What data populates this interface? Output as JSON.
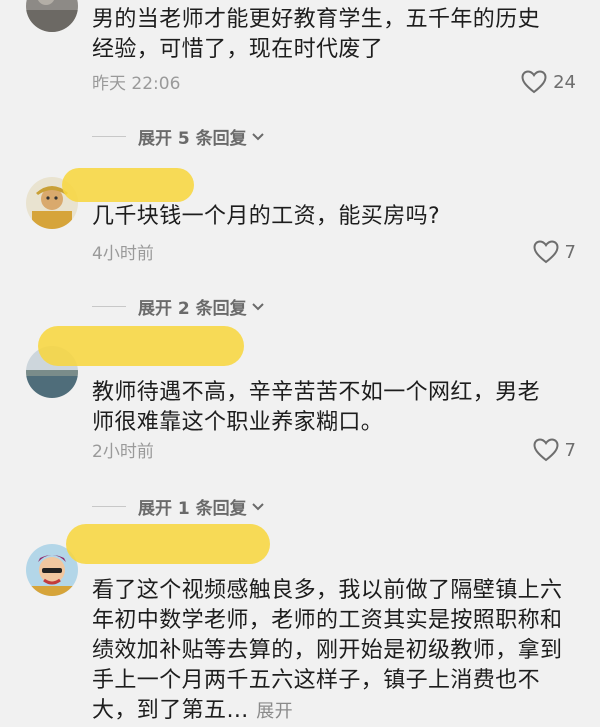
{
  "comments": [
    {
      "text": "男的当老师才能更好教育学生，五千年的历史经验，可惜了，现在时代废了",
      "time": "昨天 22:06",
      "likes": "24",
      "replies_label": "展开 5 条回复"
    },
    {
      "user": "",
      "text": "几千块钱一个月的工资，能买房吗?",
      "time": "4小时前",
      "likes": "7",
      "replies_label": "展开 2 条回复"
    },
    {
      "user": "",
      "text": "教师待遇不高，辛辛苦苦不如一个网红，男老师很难靠这个职业养家糊口。",
      "time": "2小时前",
      "likes": "7",
      "replies_label": "展开 1 条回复"
    },
    {
      "user": "",
      "text": "看了这个视频感触良多，我以前做了隔壁镇上六年初中数学老师，老师的工资其实是按照职称和绩效加补贴等去算的，刚开始是初级教师，拿到手上一个月两千五六这样子，镇子上消费也不大，到了第五…",
      "expand_label": "展开"
    }
  ]
}
